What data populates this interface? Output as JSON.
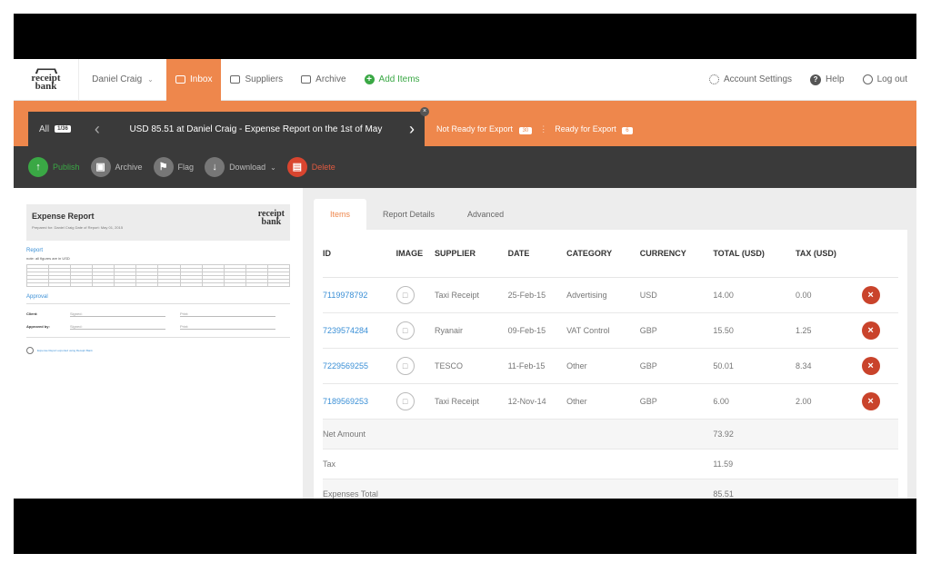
{
  "nav": {
    "user": "Daniel Craig",
    "items": [
      {
        "label": "Inbox",
        "active": true
      },
      {
        "label": "Suppliers"
      },
      {
        "label": "Archive"
      },
      {
        "label": "Add Items"
      }
    ],
    "right": [
      {
        "label": "Account Settings"
      },
      {
        "label": "Help"
      },
      {
        "label": "Log out"
      }
    ]
  },
  "docbar": {
    "all_label": "All",
    "all_count": "1/36",
    "title": "USD 85.51 at Daniel Craig - Expense Report on the 1st of May",
    "not_ready_label": "Not Ready for Export",
    "not_ready_count": "30",
    "ready_label": "Ready for Export",
    "ready_count": "6"
  },
  "actions": [
    {
      "label": "Publish"
    },
    {
      "label": "Archive"
    },
    {
      "label": "Flag"
    },
    {
      "label": "Download"
    },
    {
      "label": "Delete"
    }
  ],
  "preview": {
    "title": "Expense Report",
    "meta": "Prepared for: Daniel Craig   Date of Report: May 01, 2015",
    "report_heading": "Report",
    "note": "note: all figures are in USD",
    "approval_heading": "Approval",
    "client_label": "Client:",
    "approved_label": "Approved by:",
    "signed": "Signed:",
    "print": "Print:",
    "footer": "Expense Report exported using Receipt Bank"
  },
  "detail": {
    "tabs": [
      "Items",
      "Report Details",
      "Advanced"
    ],
    "columns": [
      "ID",
      "IMAGE",
      "SUPPLIER",
      "DATE",
      "CATEGORY",
      "CURRENCY",
      "TOTAL (USD)",
      "TAX (USD)"
    ],
    "rows": [
      {
        "id": "7119978792",
        "supplier": "Taxi Receipt",
        "date": "25-Feb-15",
        "category": "Advertising",
        "currency": "USD",
        "total": "14.00",
        "tax": "0.00"
      },
      {
        "id": "7239574284",
        "supplier": "Ryanair",
        "date": "09-Feb-15",
        "category": "VAT Control",
        "currency": "GBP",
        "total": "15.50",
        "tax": "1.25"
      },
      {
        "id": "7229569255",
        "supplier": "TESCO",
        "date": "11-Feb-15",
        "category": "Other",
        "currency": "GBP",
        "total": "50.01",
        "tax": "8.34"
      },
      {
        "id": "7189569253",
        "supplier": "Taxi Receipt",
        "date": "12-Nov-14",
        "category": "Other",
        "currency": "GBP",
        "total": "6.00",
        "tax": "2.00"
      }
    ],
    "summary": [
      {
        "label": "Net Amount",
        "value": "73.92"
      },
      {
        "label": "Tax",
        "value": "11.59"
      },
      {
        "label": "Expenses Total",
        "value": "85.51"
      }
    ]
  },
  "colors": {
    "accent": "#ee874c",
    "dark": "#3a3a3a",
    "green": "#3aa845",
    "red": "#c9432b",
    "link": "#3a8fd6"
  }
}
